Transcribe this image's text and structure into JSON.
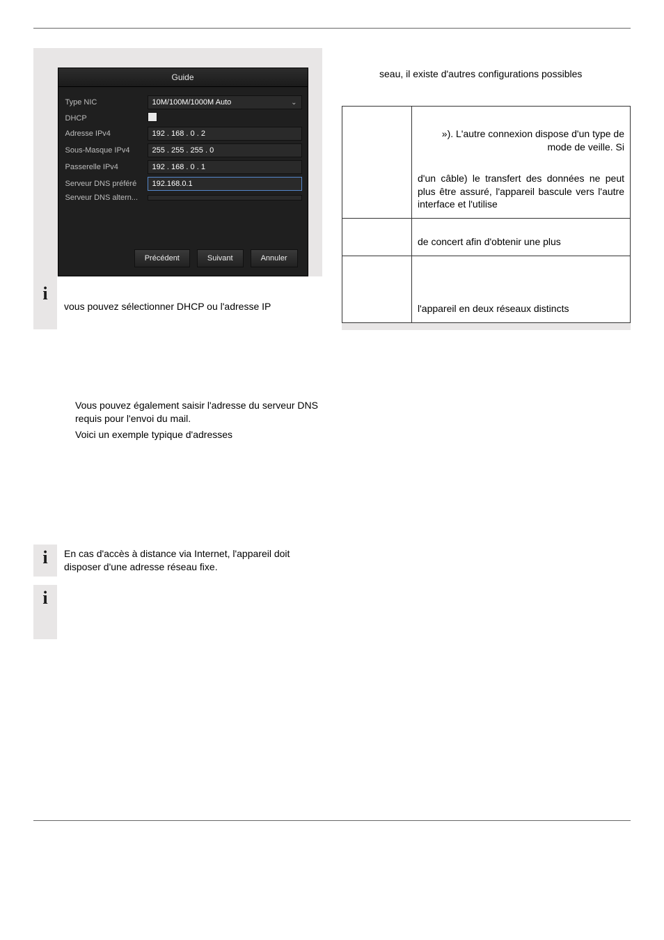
{
  "guide": {
    "title": "Guide",
    "rows": {
      "type_nic_label": "Type NIC",
      "type_nic_value": "10M/100M/1000M Auto",
      "dhcp_label": "DHCP",
      "ipv4_addr_label": "Adresse IPv4",
      "ipv4_addr_value": "192 . 168 . 0    . 2",
      "ipv4_mask_label": "Sous-Masque IPv4",
      "ipv4_mask_value": "255 . 255 . 255 . 0",
      "ipv4_gw_label": "Passerelle IPv4",
      "ipv4_gw_value": "192 . 168 . 0    . 1",
      "dns_pref_label": "Serveur DNS préféré",
      "dns_pref_value": "192.168.0.1",
      "dns_alt_label": "Serveur DNS altern..."
    },
    "buttons": {
      "prev": "Précédent",
      "next": "Suivant",
      "cancel": "Annuler"
    }
  },
  "info": {
    "note1": "vous pouvez sélectionner DHCP ou l'adresse IP",
    "dns1": "Vous pouvez également saisir l'adresse du serveur DNS requis pour l'envoi du mail.",
    "dns2": "Voici un exemple typique d'adresses",
    "remote1": "En cas d'accès à distance via Internet, l'appareil doit disposer d'une adresse réseau fixe."
  },
  "right": {
    "intro": "seau, il existe d'autres configurations possibles",
    "row1a": " »). L'autre connexion dispose d'un type de mode de veille. Si",
    "row1b": "d'un câble) le transfert des données ne peut plus être assuré, l'appareil bascule vers l'autre interface et l'utilise",
    "row2": "de concert afin d'obtenir une plus",
    "row3": "l'appareil en deux réseaux distincts"
  }
}
